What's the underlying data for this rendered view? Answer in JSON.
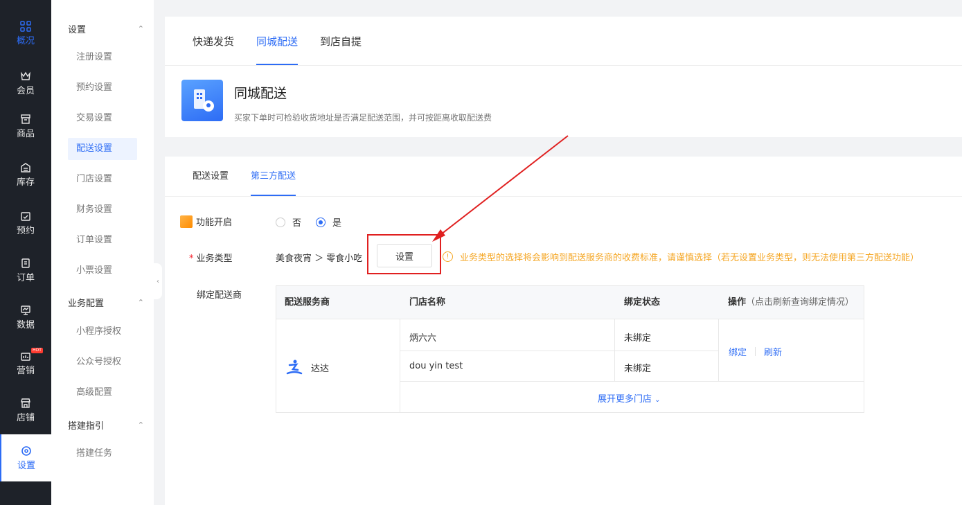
{
  "rail": {
    "items": [
      {
        "label": "概况",
        "icon": "grid-icon"
      },
      {
        "label": "会员",
        "icon": "crown-icon"
      },
      {
        "label": "商品",
        "icon": "store-box-icon"
      },
      {
        "label": "库存",
        "icon": "inventory-icon"
      },
      {
        "label": "预约",
        "icon": "calendar-check-icon"
      },
      {
        "label": "订单",
        "icon": "clipboard-icon"
      },
      {
        "label": "数据",
        "icon": "chart-monitor-icon"
      },
      {
        "label": "营销",
        "icon": "marketing-icon"
      },
      {
        "label": "店铺",
        "icon": "shop-icon"
      },
      {
        "label": "设置",
        "icon": "gear-icon"
      }
    ],
    "hot_badge": "HOT"
  },
  "submenu": {
    "group1": "设置",
    "group1_items": [
      "注册设置",
      "预约设置",
      "交易设置",
      "配送设置",
      "门店设置",
      "财务设置",
      "订单设置",
      "小票设置"
    ],
    "group2": "业务配置",
    "group2_items": [
      "小程序授权",
      "公众号授权",
      "高级配置"
    ],
    "group3": "搭建指引",
    "group3_items": [
      "搭建任务"
    ]
  },
  "top_tabs": [
    "快递发货",
    "同城配送",
    "到店自提"
  ],
  "feature": {
    "title": "同城配送",
    "desc": "买家下单时可检验收货地址是否满足配送范围，并可按距离收取配送费"
  },
  "sub_tabs": [
    "配送设置",
    "第三方配送"
  ],
  "form": {
    "enable_label": "功能开启",
    "opt_no": "否",
    "opt_yes": "是",
    "biz_label": "业务类型",
    "biz_value": "美食夜宵 ＞ 零食小吃",
    "setup_btn": "设置",
    "warning": "业务类型的选择将会影响到配送服务商的收费标准，请谨慎选择（若无设置业务类型，则无法使用第三方配送功能）",
    "bind_label": "绑定配送商"
  },
  "table": {
    "headers": {
      "provider": "配送服务商",
      "store": "门店名称",
      "status": "绑定状态",
      "action": "操作",
      "action_hint": "（点击刷新查询绑定情况）"
    },
    "provider_name": "达达",
    "rows": [
      {
        "store": "炳六六",
        "status": "未绑定"
      },
      {
        "store": "dou yin test",
        "status": "未绑定"
      }
    ],
    "bind_link": "绑定",
    "refresh_link": "刷新",
    "expand": "展开更多门店"
  }
}
